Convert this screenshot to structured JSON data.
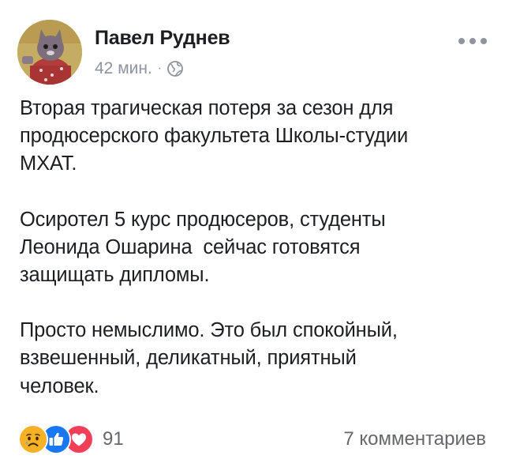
{
  "post": {
    "author": "Павел Руднев",
    "time": "42 мин.",
    "separator": "·",
    "privacy_icon": "globe-icon",
    "more_icon": "more-options-icon",
    "paragraphs": [
      [
        "Вторая трагическая потеря за сезон для",
        "продюсерского факультета Школы-студии",
        "МХАТ."
      ],
      [
        "Осиротел 5 курс продюсеров, студенты",
        "Леонида Ошарина  сейчас готовятся",
        "защищать дипломы."
      ],
      [
        "Просто немыслимо. Это был спокойный,",
        "взвешенный, деликатный, приятный",
        "человек."
      ]
    ]
  },
  "footer": {
    "reaction_icons": [
      "sad-reaction-icon",
      "like-reaction-icon",
      "love-reaction-icon"
    ],
    "reaction_count": "91",
    "comments_label": "7 комментариев"
  },
  "colors": {
    "text": "#1c1e21",
    "meta": "#8d949e",
    "like": "#1877f2",
    "love": "#f33e58",
    "sad": "#f7b125"
  }
}
